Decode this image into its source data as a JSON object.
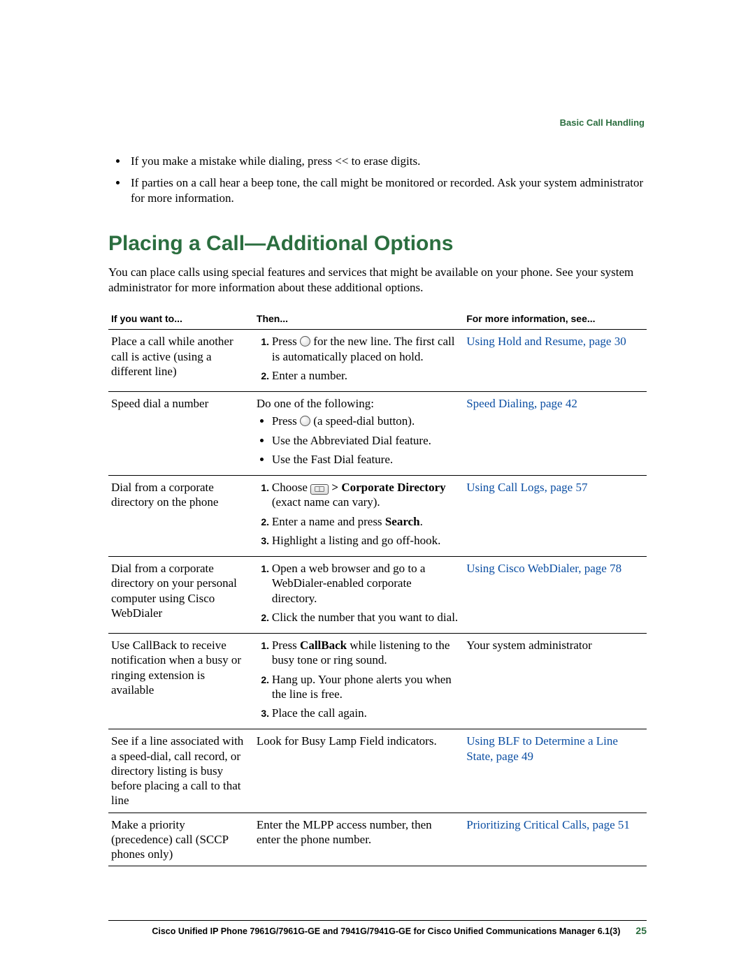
{
  "chapter_tag": "Basic Call Handling",
  "intro_bullets": [
    "If you make a mistake while dialing, press << to erase digits.",
    "If parties on a call hear a beep tone, the call might be monitored or recorded. Ask your system administrator for more information."
  ],
  "section_title": "Placing a Call—Additional Options",
  "section_lead": "You can place calls using special features and services that might be available on your phone. See your system administrator for more information about these additional options.",
  "table": {
    "headers": {
      "c1": "If you want to...",
      "c2": "Then...",
      "c3": "For more information, see..."
    },
    "rows": [
      {
        "want": "Place a call while another call is active (using a different line)",
        "then_before_icon": "Press ",
        "then_after_icon": " for the new line. The first call is automatically placed on hold.",
        "step2": "Enter a number.",
        "info": "Using Hold and Resume, page 30"
      },
      {
        "want": "Speed dial a number",
        "lead": "Do one of the following:",
        "opt1_before": "Press ",
        "opt1_after": " (a speed-dial button).",
        "opt2": "Use the Abbreviated Dial feature.",
        "opt3": "Use the Fast Dial feature.",
        "info": "Speed Dialing, page 42"
      },
      {
        "want": "Dial from a corporate directory on the phone",
        "s1_before": "Choose ",
        "s1_bold": " > Corporate Directory",
        "s1_after": " (exact name can vary).",
        "s2_a": "Enter a name and press ",
        "s2_bold": "Search",
        "s2_b": ".",
        "s3": "Highlight a listing and go off-hook.",
        "info": "Using Call Logs, page 57"
      },
      {
        "want": "Dial from a corporate directory on your personal computer using Cisco WebDialer",
        "s1": "Open a web browser and go to a WebDialer-enabled corporate directory.",
        "s2": "Click the number that you want to dial.",
        "info": "Using Cisco WebDialer, page 78"
      },
      {
        "want": "Use CallBack to receive notification when a busy or ringing extension is available",
        "s1_a": "Press ",
        "s1_bold": "CallBack",
        "s1_b": " while listening to the busy tone or ring sound.",
        "s2": "Hang up. Your phone alerts you when the line is free.",
        "s3": "Place the call again.",
        "info": "Your system administrator"
      },
      {
        "want": "See if a line associated with a speed-dial, call record, or directory listing is busy before placing a call to that line",
        "then": "Look for Busy Lamp Field indicators.",
        "info": "Using BLF to Determine a Line State, page 49"
      },
      {
        "want": "Make a priority (precedence) call (SCCP phones only)",
        "then": "Enter the MLPP access number, then enter the phone number.",
        "info": "Prioritizing Critical Calls, page 51"
      }
    ]
  },
  "footer": {
    "doc": "Cisco Unified IP Phone 7961G/7961G-GE and 7941G/7941G-GE for Cisco Unified Communications Manager 6.1(3)",
    "page": "25"
  }
}
